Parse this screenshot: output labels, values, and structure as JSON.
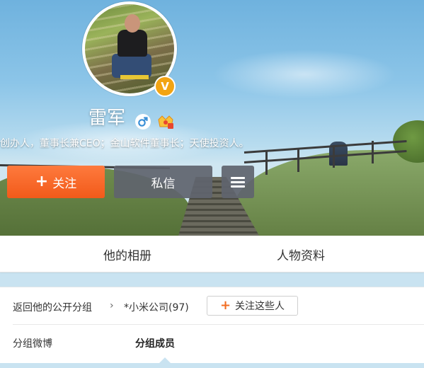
{
  "profile": {
    "name": "雷军",
    "bio": "创办人，董事长兼CEO；金山软件董事长；天使投资人。",
    "verified_badge": "V",
    "gender_icon": "male-icon",
    "vip_icon": "vip-crown-icon"
  },
  "actions": {
    "follow_label": "关注",
    "message_label": "私信",
    "menu_icon": "hamburger-menu-icon"
  },
  "tabs": [
    {
      "label": "他的相册"
    },
    {
      "label": "人物资料"
    }
  ],
  "group": {
    "back_label": "返回他的公开分组",
    "separator": "›",
    "current_group": "*小米公司(97)",
    "follow_these_label": "关注这些人",
    "subtabs": [
      {
        "label": "分组微博",
        "active": false
      },
      {
        "label": "分组成员",
        "active": true
      }
    ]
  },
  "colors": {
    "follow_button": "#f25a1a",
    "secondary_button": "#60646e",
    "verified": "#f2a413",
    "gender": "#3a8fd6"
  }
}
